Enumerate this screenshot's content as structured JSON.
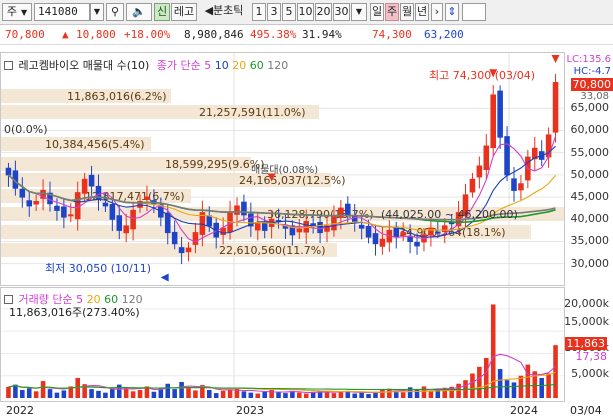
{
  "toolbar": {
    "market_label": "주",
    "code": "141080",
    "sin_label": "신",
    "name_label": "레고",
    "bunchart_label": "◀분초틱",
    "periods": [
      "1",
      "3",
      "5",
      "10",
      "20",
      "30"
    ],
    "day_label": "일",
    "week_label": "주",
    "month_label": "월",
    "year_label": "년"
  },
  "price_bar": {
    "price": "70,800",
    "change_arrow": "▲",
    "change": "10,800",
    "change_pct": "+18.00%",
    "volume": "8,980,846",
    "volume_ratio": "495.38%",
    "turnover": "31.94%",
    "high": "74,300",
    "low": "63,200"
  },
  "main_chart": {
    "title": "레고켐바이오 매물대 수(10)",
    "ma_label": "종가 단순",
    "ma_periods": [
      "5",
      "10",
      "20",
      "60",
      "120"
    ],
    "ma_colors": [
      "#d040d0",
      "#1a3fb8",
      "#e8a810",
      "#1a9a2a",
      "#7a7a7a"
    ],
    "zero_label": "0(0.0%)",
    "volume_profile": [
      "11,863,016(6.2%)",
      "21,257,591(11.0%)",
      "10,384,456(5.4%)",
      "18,599,295(9.6%)",
      "24,165,037(12.5%)",
      "12,817,471(6.7%)",
      "36,128,790(18.7%)",
      "34,900,564(18.1%)",
      "22,610,560(11.7%)"
    ],
    "bearish_marker": "매물대(0.08%)",
    "range_label": "(44,025.00 ~ 46,200.00)",
    "max_label": "최고 74,300 (03/04)",
    "min_label": "최저 30,050 (10/11)",
    "lc_label": "LC:135.6",
    "hc_label": "HC:-4.7",
    "y_ticks": [
      "65,000",
      "60,000",
      "55,000",
      "50,000",
      "45,000",
      "40,000",
      "35,000",
      "30,000"
    ],
    "last_price_tag": "70,800",
    "upper_tag": "33,08"
  },
  "volume_chart": {
    "title": "거래량 단순",
    "ma_periods": [
      "5",
      "20",
      "60",
      "120"
    ],
    "ma_colors": [
      "#d040d0",
      "#e8a810",
      "#1a9a2a",
      "#7a7a7a"
    ],
    "value_label": "11,863,016주(273.40%)",
    "y_ticks": [
      "20,000k",
      "15,000k",
      "10,000k",
      "5,000k"
    ],
    "tags": [
      "11,863",
      "17,38"
    ]
  },
  "x_axis": {
    "labels": [
      "2022",
      "2023",
      "2024",
      "03/04"
    ]
  },
  "chart_data": {
    "type": "candlestick",
    "title": "레고켐바이오 매물대 수(10)",
    "y_range": [
      27000,
      74300
    ],
    "y_ticks": [
      30000,
      35000,
      40000,
      45000,
      50000,
      55000,
      60000,
      65000
    ],
    "x_labels": [
      "2022",
      "2023",
      "2024",
      "03/04"
    ],
    "close": [
      50000,
      47000,
      45000,
      43000,
      44000,
      46500,
      43500,
      42000,
      40500,
      41000,
      46000,
      49000,
      47500,
      44500,
      43000,
      40000,
      37500,
      38500,
      42000,
      44000,
      45000,
      43500,
      40500,
      37000,
      34500,
      32500,
      33500,
      37000,
      41500,
      38500,
      36000,
      38000,
      41500,
      43000,
      41000,
      38500,
      39000,
      37500,
      40000,
      39500,
      38000,
      36500,
      37800,
      39500,
      38500,
      37000,
      38500,
      40500,
      42500,
      41000,
      39500,
      38000,
      36000,
      34500,
      35500,
      37500,
      36000,
      37000,
      35000,
      34000,
      36500,
      38000,
      37000,
      38500,
      39000,
      41500,
      45500,
      49000,
      52000,
      56500,
      68000,
      58500,
      50000,
      46500,
      48000,
      54000,
      56000,
      53500,
      59000,
      70800
    ],
    "ma_values": {
      "120": 47000
    },
    "volume": [
      2.5,
      3.0,
      1.8,
      2.2,
      1.5,
      3.8,
      2.0,
      1.2,
      1.7,
      2.6,
      4.5,
      3.1,
      2.0,
      1.6,
      1.2,
      2.1,
      3.0,
      2.4,
      1.5,
      1.8,
      2.6,
      1.4,
      2.2,
      3.2,
      2.0,
      3.6,
      2.5,
      1.7,
      2.9,
      1.8,
      1.1,
      1.6,
      1.9,
      2.3,
      1.5,
      1.2,
      1.0,
      1.4,
      1.8,
      1.3,
      1.1,
      1.6,
      1.2,
      1.0,
      1.4,
      1.7,
      1.3,
      1.1,
      1.5,
      1.6,
      1.0,
      1.2,
      0.9,
      1.4,
      1.8,
      2.1,
      1.7,
      1.3,
      2.4,
      1.9,
      2.6,
      1.5,
      1.9,
      2.3,
      2.5,
      3.2,
      4.0,
      5.5,
      7.0,
      9.0,
      21.0,
      6.5,
      4.0,
      3.5,
      5.0,
      7.5,
      6.0,
      4.5,
      5.5,
      11.86
    ]
  }
}
